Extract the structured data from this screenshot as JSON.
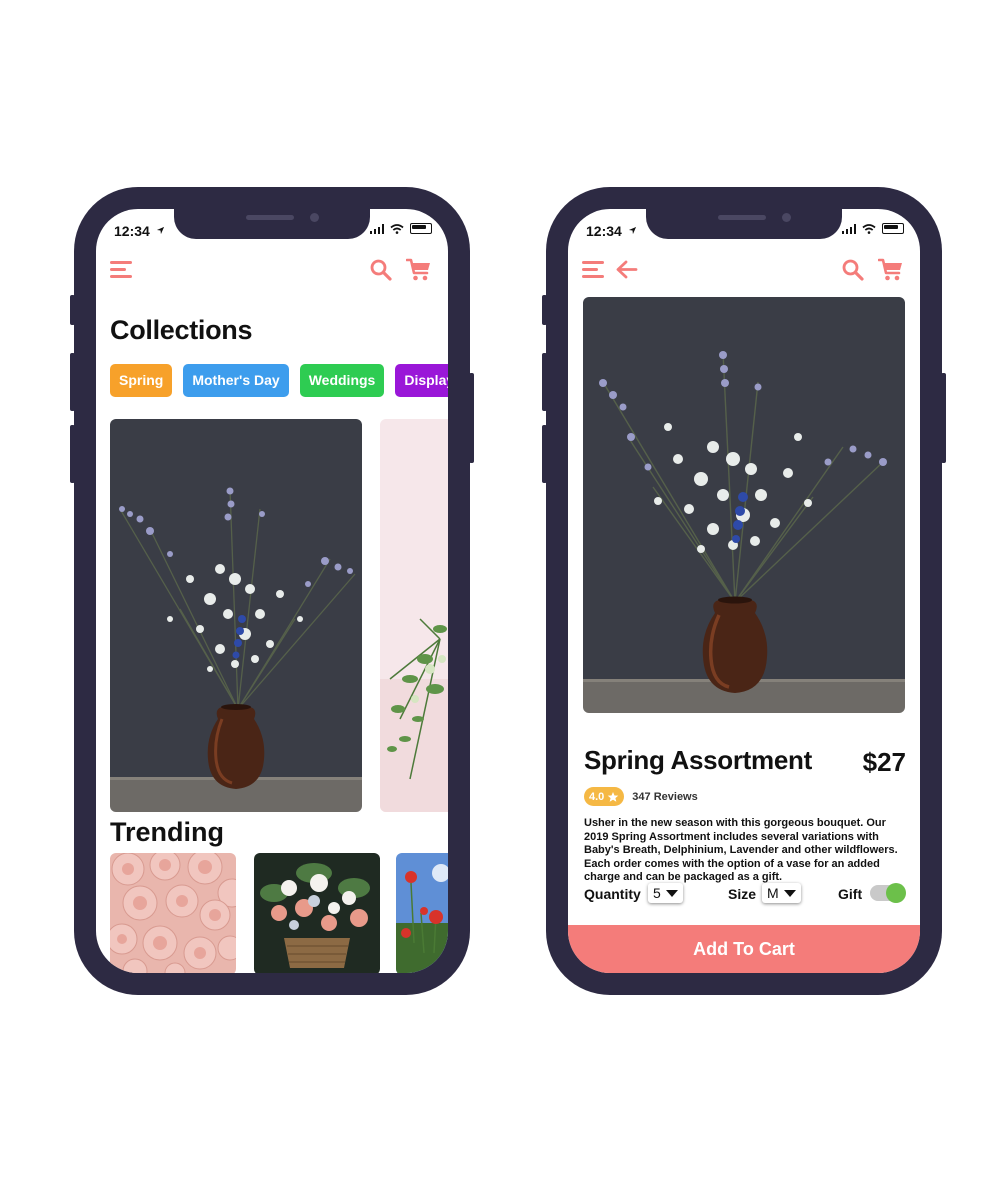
{
  "colors": {
    "phone_frame": "#2d2a43",
    "accent": "#f47c7a",
    "rating_badge": "#f5b844",
    "toggle_on": "#6cc04a"
  },
  "collections_screen": {
    "status": {
      "time": "12:34"
    },
    "header": {
      "menu_icon": "hamburger-menu-icon",
      "search_icon": "search-icon",
      "cart_icon": "cart-icon"
    },
    "title": "Collections",
    "chips": [
      {
        "label": "Spring",
        "color": "#f7a12a"
      },
      {
        "label": "Mother's Day",
        "color": "#3d9ded"
      },
      {
        "label": "Weddings",
        "color": "#2ecc52"
      },
      {
        "label": "Displays",
        "color": "#9a17d8"
      }
    ],
    "trending_title": "Trending"
  },
  "product_screen": {
    "status": {
      "time": "12:34"
    },
    "header": {
      "menu_icon": "hamburger-menu-icon",
      "back_icon": "arrow-left-icon",
      "search_icon": "search-icon",
      "cart_icon": "cart-icon"
    },
    "product": {
      "name": "Spring Assortment",
      "price": "$27",
      "rating": "4.0",
      "reviews": "347 Reviews",
      "description": "Usher in the new season with this gorgeous bouquet. Our 2019 Spring Assortment includes several variations with Baby's Breath, Delphinium, Lavender and other wildflowers. Each order comes with the option of a vase for an added charge and can be packaged as a gift."
    },
    "options": {
      "quantity_label": "Quantity",
      "quantity_value": "5",
      "size_label": "Size",
      "size_value": "M",
      "gift_label": "Gift",
      "gift_on": true
    },
    "cta": "Add To Cart"
  }
}
